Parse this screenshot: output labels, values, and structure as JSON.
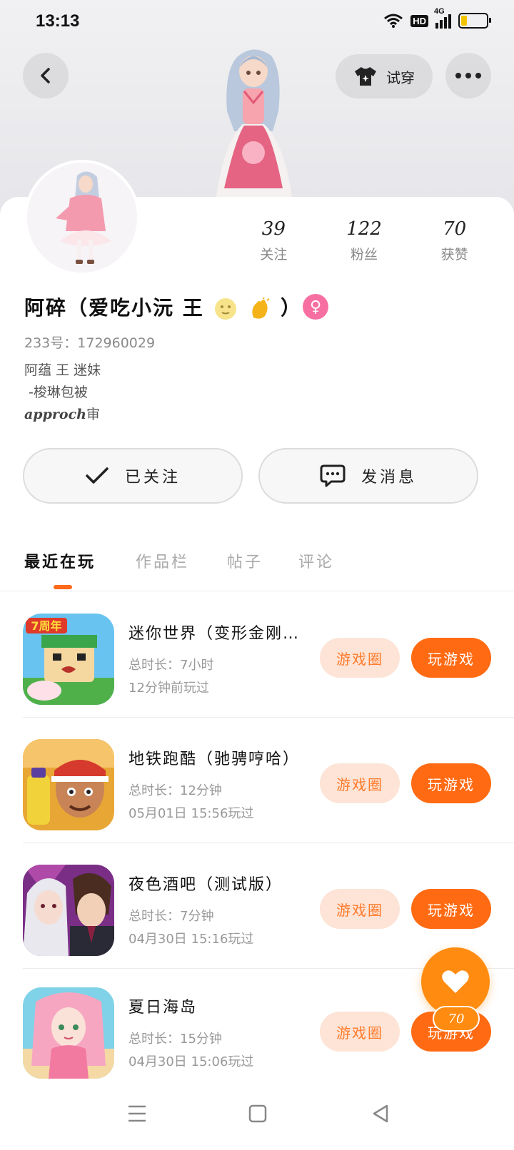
{
  "status_bar": {
    "time": "13:13",
    "hd": "HD",
    "network": "4G"
  },
  "header": {
    "tryon_label": "试穿"
  },
  "profile": {
    "stats": [
      {
        "value": "39",
        "label": "关注"
      },
      {
        "value": "122",
        "label": "粉丝"
      },
      {
        "value": "70",
        "label": "获赞"
      }
    ],
    "name_prefix": "阿碎（爱吃小沅 王",
    "name_suffix": "）",
    "gender_symbol": "♀",
    "id_line": "233号：172960029",
    "bio": "阿蕴 王 迷妹\n -梭琳包被",
    "bio_signature": "approch",
    "bio_signature_tail": "审"
  },
  "actions": {
    "followed_label": "已关注",
    "message_label": "发消息"
  },
  "tabs": [
    {
      "label": "最近在玩",
      "active": true
    },
    {
      "label": "作品栏",
      "active": false
    },
    {
      "label": "帖子",
      "active": false
    },
    {
      "label": "评论",
      "active": false
    }
  ],
  "games": [
    {
      "title": "迷你世界（变形金刚联动）",
      "duration": "总时长：7小时",
      "last_played": "12分钟前玩过",
      "circle_label": "游戏圈",
      "play_label": "玩游戏",
      "badge": "7周年"
    },
    {
      "title": "地铁跑酷（驰骋哼哈）",
      "duration": "总时长：12分钟",
      "last_played": "05月01日 15:56玩过",
      "circle_label": "游戏圈",
      "play_label": "玩游戏"
    },
    {
      "title": "夜色酒吧（测试版）",
      "duration": "总时长：7分钟",
      "last_played": "04月30日 15:16玩过",
      "circle_label": "游戏圈",
      "play_label": "玩游戏"
    },
    {
      "title": "夏日海岛",
      "duration": "总时长：15分钟",
      "last_played": "04月30日 15:06玩过",
      "circle_label": "游戏圈",
      "play_label": "玩游戏"
    }
  ],
  "like_fab": {
    "count": "70"
  },
  "colors": {
    "accent": "#ff6a12",
    "accent_light": "#fde4d6",
    "gender": "#f76fa0",
    "fab": "#ff8c10"
  }
}
